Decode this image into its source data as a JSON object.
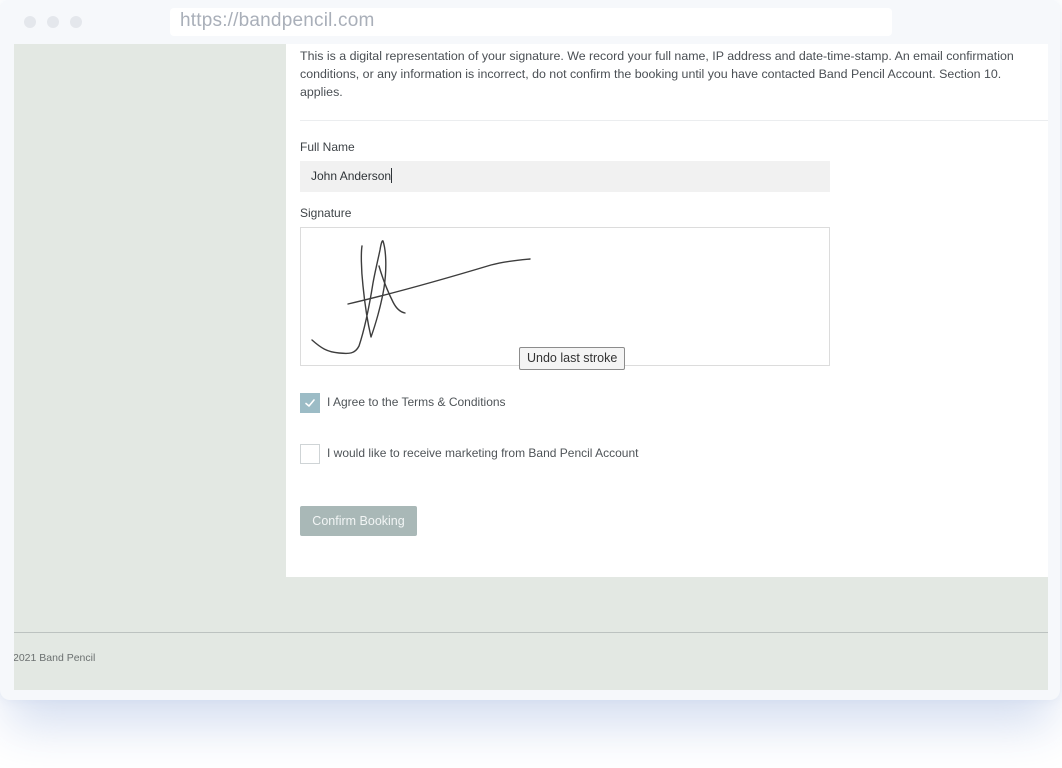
{
  "browser": {
    "url": "https://bandpencil.com"
  },
  "form": {
    "notice_lines": [
      "This is a digital representation of your signature. We record your full name, IP address and date-time-stamp. An email confirmation",
      "conditions, or any information is incorrect, do not confirm the booking until you have contacted Band Pencil Account. Section 10.",
      "applies."
    ],
    "full_name_label": "Full Name",
    "full_name_value": "John Anderson",
    "signature_label": "Signature",
    "undo_label": "Undo last stroke",
    "terms_label": "I Agree to the Terms & Conditions",
    "terms_checked": true,
    "marketing_label": "I would like to receive marketing from Band Pencil Account",
    "marketing_checked": false,
    "confirm_label": "Confirm Booking"
  },
  "footer": {
    "copyright": "2021 Band Pencil"
  },
  "icons": {
    "checkmark": "check-icon"
  },
  "colors": {
    "checkbox_checked": "#9cbcc6",
    "confirm_button": "#a9b8b7",
    "page_background": "#e3e8e3"
  }
}
